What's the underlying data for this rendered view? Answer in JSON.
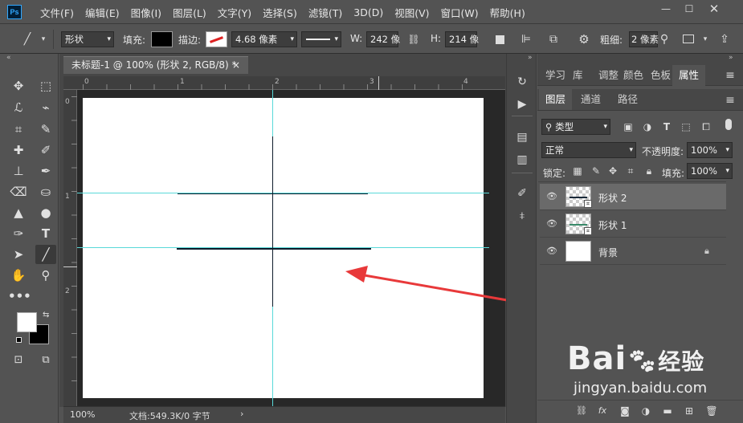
{
  "menubar": {
    "app_logo": "Ps",
    "items": [
      "文件(F)",
      "编辑(E)",
      "图像(I)",
      "图层(L)",
      "文字(Y)",
      "选择(S)",
      "滤镜(T)",
      "3D(D)",
      "视图(V)",
      "窗口(W)",
      "帮助(H)"
    ]
  },
  "options": {
    "shape_mode": "形状",
    "fill_label": "填充:",
    "stroke_label": "描边:",
    "stroke_width": "4.68 像素",
    "w_label": "W:",
    "w_value": "242 像",
    "h_label": "H:",
    "h_value": "214 像",
    "weight_label": "粗细:",
    "weight_value": "2 像素"
  },
  "document": {
    "tab_title": "未标题-1 @ 100% (形状 2, RGB/8) *",
    "close": "×",
    "ruler_h_numbers": [
      "0",
      "1",
      "2",
      "3",
      "4"
    ],
    "ruler_v_numbers": [
      "0",
      "1",
      "2"
    ],
    "zoom": "100%",
    "doc_info": "文档:549.3K/0 字节",
    "status_arrow": "›"
  },
  "panel_tabs_top": [
    "学习",
    "库",
    "调整",
    "颜色",
    "色板",
    "属性"
  ],
  "panel_tabs_layers": [
    "图层",
    "通道",
    "路径"
  ],
  "layers_panel": {
    "filter_kind": "类型",
    "blend_mode": "正常",
    "opacity_label": "不透明度:",
    "opacity_value": "100%",
    "lock_label": "锁定:",
    "fill_label": "填充:",
    "fill_value": "100%",
    "layers": [
      {
        "name": "形状 2",
        "selected": true
      },
      {
        "name": "形状 1",
        "selected": false
      },
      {
        "name": "背景",
        "selected": false
      }
    ]
  },
  "watermark": {
    "brand": "Bai",
    "brand2": "经验",
    "url": "jingyan.baidu.com"
  },
  "colors": {
    "guide": "#59d9d9",
    "arrow": "#e8393a",
    "selection": "#6a6a6a"
  }
}
